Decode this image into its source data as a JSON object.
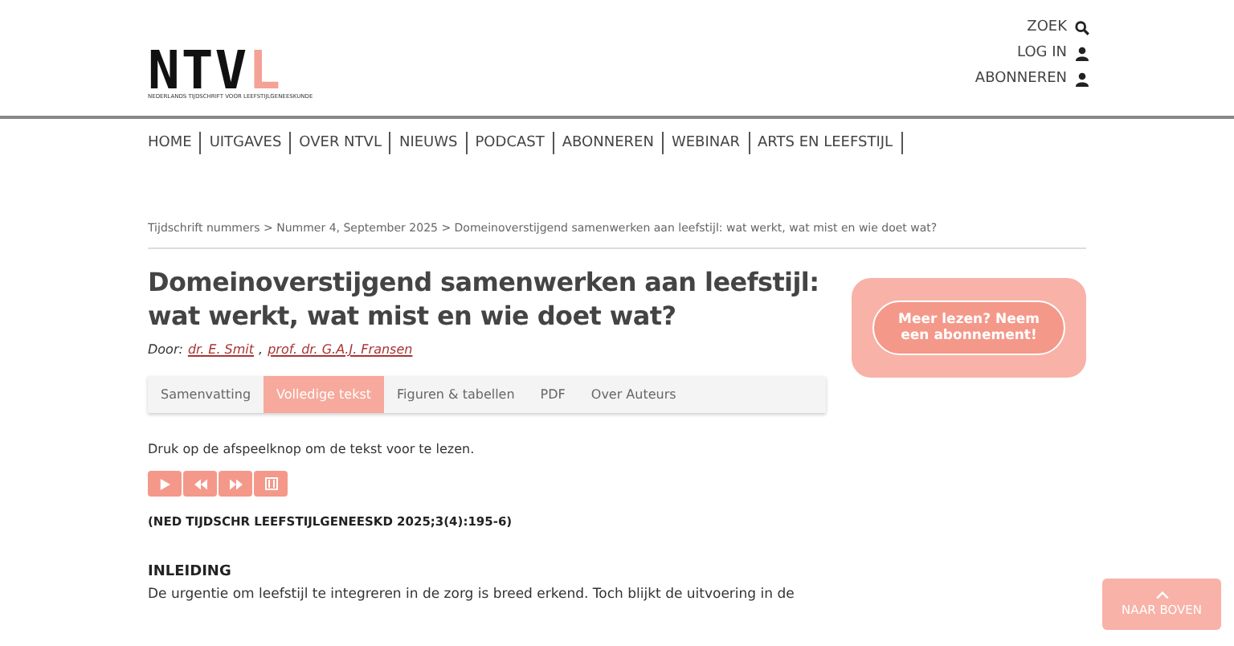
{
  "logo": {
    "letters": [
      {
        "char": "N",
        "accent": false
      },
      {
        "char": "T",
        "accent": false
      },
      {
        "char": "V",
        "accent": false
      },
      {
        "char": "L",
        "accent": true
      }
    ],
    "subtitle": "NEDERLANDS TIJDSCHRIFT VOOR LEEFSTIJLGENEESKUNDE"
  },
  "top_links": [
    {
      "label": "ZOEK",
      "kind": "search"
    },
    {
      "label": "LOG IN",
      "kind": "user"
    },
    {
      "label": "ABONNEREN",
      "kind": "user"
    }
  ],
  "nav": [
    "HOME",
    "UITGAVES",
    "OVER NTVL",
    "NIEUWS",
    "PODCAST",
    "ABONNEREN",
    "WEBINAR",
    "ARTS EN LEEFSTIJL"
  ],
  "breadcrumb": "Tijdschrift nummers > Nummer 4, September 2025 > Domeinoverstijgend samenwerken aan leefstijl: wat werkt, wat mist en wie doet wat?",
  "title": "Domeinoverstijgend samenwerken aan leefstijl: wat werkt, wat mist en wie doet wat?",
  "byline": {
    "prefix": "Door:",
    "authors": [
      "dr. E. Smit ",
      "prof. dr. G.A.J. Fransen"
    ],
    "separator": ","
  },
  "tabs": [
    {
      "label": "Samenvatting",
      "selected": false
    },
    {
      "label": "Volledige tekst",
      "selected": true
    },
    {
      "label": "Figuren & tabellen",
      "selected": false
    },
    {
      "label": "PDF",
      "selected": false
    },
    {
      "label": "Over Auteurs",
      "selected": false
    }
  ],
  "player_hint": "Druk op de afspeelknop om de tekst voor te lezen.",
  "player_buttons": [
    {
      "kind": "play"
    },
    {
      "kind": "rewind"
    },
    {
      "kind": "forward"
    },
    {
      "kind": "settings"
    }
  ],
  "citation": "(NED TIJDSCHR LEEFSTIJLGENEESKD 2025;3(4):195-6)",
  "section_heading": "INLEIDING",
  "paragraph": "De urgentie om leefstijl te integreren in de zorg is breed erkend. Toch blijkt de uitvoering in de",
  "promo": "Meer lezen? Neem een abonnement!",
  "back_to_top": "NAAR BOVEN"
}
